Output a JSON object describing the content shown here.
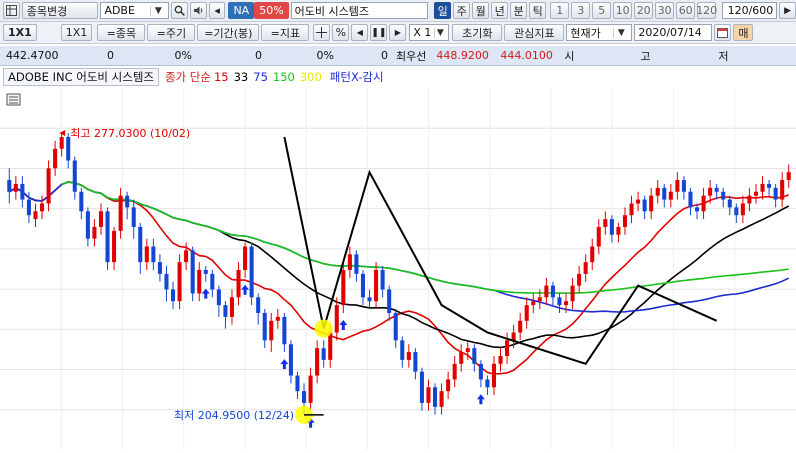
{
  "toolbar": {
    "mode_icon": "grid-icon",
    "code_change_label": "종목변경",
    "ticker": "ADBE",
    "name_na_badge": "NA",
    "name_pct_badge": "50%",
    "company_name": "어도비 시스템즈",
    "periods": [
      "일",
      "주",
      "월",
      "년",
      "분",
      "틱"
    ],
    "selected_period": "일",
    "intervals": [
      "1",
      "3",
      "5",
      "10",
      "20",
      "30",
      "60",
      "120"
    ],
    "count_display": "120/600",
    "date_nav_label": "▶"
  },
  "toolbar2": {
    "btn_1x1": "1X1",
    "btn_1x1_b": "1X1",
    "btn_items": "=종목",
    "btn_period": "=주기",
    "btn_range": "=기간(봉)",
    "btn_indicator": "=지표",
    "multiplier": "X 1",
    "reset_label": "초기화",
    "favorite_label": "관심지표",
    "price_type": "현재가",
    "date": "2020/07/14",
    "more_label": "매"
  },
  "quote": {
    "price": "442.4700",
    "change": "0",
    "change_pct": "0%",
    "volume": "0",
    "volume_pct": "0%",
    "ask_label": "최우선",
    "ask_price": "448.9200",
    "bid_price": "444.0100",
    "open_label": "시",
    "high_label": "고",
    "low_label": "저"
  },
  "legend": {
    "title": "ADOBE INC 어도비 시스템즈",
    "ma_prefix": "종가 단순",
    "ma_periods": [
      "15",
      "33",
      "75",
      "150",
      "300"
    ],
    "ma_colors": [
      "#e00000",
      "#000000",
      "#1d2bd0",
      "#19c219",
      "#e8e800"
    ],
    "pattern_label": "패턴X-감시"
  },
  "chart_data": {
    "type": "candlestick",
    "title": "ADOBE INC 어도비 시스템즈",
    "xlabel": "",
    "ylabel": "",
    "ylim": [
      198,
      287
    ],
    "x": [
      0,
      1,
      2,
      3,
      4,
      5,
      6,
      7,
      8,
      9,
      10,
      11,
      12,
      13,
      14,
      15,
      16,
      17,
      18,
      19,
      20,
      21,
      22,
      23,
      24,
      25,
      26,
      27,
      28,
      29,
      30,
      31,
      32,
      33,
      34,
      35,
      36,
      37,
      38,
      39,
      40,
      41,
      42,
      43,
      44,
      45,
      46,
      47,
      48,
      49,
      50,
      51,
      52,
      53,
      54,
      55,
      56,
      57,
      58,
      59,
      60,
      61,
      62,
      63,
      64,
      65,
      66,
      67,
      68,
      69,
      70,
      71,
      72,
      73,
      74,
      75,
      76,
      77,
      78,
      79,
      80,
      81,
      82,
      83,
      84,
      85,
      86,
      87,
      88,
      89,
      90,
      91,
      92,
      93,
      94,
      95,
      96,
      97,
      98,
      99,
      100,
      101,
      102,
      103,
      104,
      105,
      106,
      107,
      108,
      109,
      110,
      111,
      112,
      113,
      114,
      115,
      116,
      117,
      118,
      119
    ],
    "candles": {
      "open": [
        265,
        262,
        264,
        260,
        255,
        257,
        259,
        268,
        273,
        276,
        270,
        262,
        257,
        250,
        253,
        257,
        244,
        252,
        261,
        258,
        253,
        244,
        248,
        244,
        241,
        237,
        234,
        244,
        247,
        236,
        242,
        241,
        237,
        233,
        230,
        235,
        242,
        248,
        235,
        231,
        224,
        229,
        230,
        223,
        215,
        211,
        208,
        215,
        222,
        219,
        226,
        233,
        242,
        246,
        241,
        235,
        234,
        242,
        237,
        231,
        224,
        219,
        221,
        216,
        208,
        212,
        207,
        211,
        214,
        218,
        221,
        222,
        218,
        214,
        212,
        218,
        220,
        224,
        226,
        229,
        233,
        234,
        235,
        238,
        235,
        233,
        234,
        238,
        241,
        244,
        248,
        253,
        255,
        251,
        253,
        256,
        259,
        260,
        257,
        261,
        263,
        260,
        262,
        265,
        262,
        258,
        257,
        261,
        263,
        262,
        260,
        258,
        256,
        259,
        261,
        262,
        264,
        263,
        260,
        265
      ],
      "close": [
        262,
        264,
        260,
        256,
        257,
        259,
        268,
        273,
        276,
        270,
        262,
        257,
        250,
        253,
        257,
        244,
        252,
        261,
        258,
        253,
        244,
        248,
        244,
        241,
        237,
        234,
        244,
        247,
        236,
        242,
        241,
        237,
        233,
        230,
        235,
        242,
        248,
        235,
        231,
        224,
        229,
        230,
        223,
        215,
        211,
        208,
        215,
        222,
        219,
        226,
        233,
        242,
        246,
        241,
        235,
        234,
        242,
        237,
        231,
        224,
        219,
        221,
        216,
        208,
        212,
        207,
        211,
        214,
        218,
        221,
        222,
        218,
        214,
        212,
        218,
        220,
        224,
        226,
        229,
        233,
        234,
        235,
        238,
        235,
        233,
        234,
        238,
        241,
        244,
        248,
        253,
        255,
        251,
        253,
        256,
        259,
        260,
        257,
        261,
        263,
        260,
        262,
        265,
        262,
        258,
        257,
        261,
        263,
        262,
        260,
        258,
        256,
        259,
        261,
        262,
        264,
        263,
        260,
        265,
        267
      ],
      "high": [
        268,
        266,
        266,
        262,
        259,
        261,
        270,
        275,
        277,
        277,
        271,
        263,
        258,
        255,
        259,
        258,
        253,
        263,
        262,
        260,
        254,
        250,
        250,
        246,
        243,
        239,
        246,
        249,
        248,
        244,
        243,
        242,
        238,
        234,
        237,
        244,
        249,
        249,
        236,
        232,
        231,
        232,
        231,
        224,
        216,
        213,
        217,
        224,
        224,
        228,
        235,
        244,
        248,
        247,
        242,
        237,
        244,
        243,
        238,
        232,
        225,
        223,
        222,
        217,
        214,
        213,
        213,
        216,
        220,
        223,
        224,
        223,
        219,
        215,
        220,
        222,
        226,
        228,
        231,
        235,
        236,
        237,
        240,
        239,
        236,
        236,
        240,
        243,
        246,
        250,
        255,
        257,
        256,
        254,
        258,
        261,
        262,
        261,
        263,
        265,
        264,
        264,
        267,
        266,
        263,
        259,
        263,
        265,
        264,
        263,
        261,
        259,
        261,
        263,
        264,
        266,
        265,
        264,
        267,
        269
      ],
      "low": [
        259,
        260,
        258,
        254,
        253,
        255,
        257,
        266,
        271,
        268,
        260,
        255,
        248,
        248,
        251,
        242,
        242,
        250,
        255,
        250,
        241,
        242,
        242,
        239,
        234,
        232,
        232,
        242,
        234,
        234,
        239,
        235,
        230,
        227,
        228,
        233,
        240,
        233,
        228,
        222,
        221,
        227,
        221,
        213,
        209,
        205,
        206,
        213,
        217,
        217,
        224,
        231,
        240,
        239,
        233,
        232,
        232,
        235,
        229,
        222,
        217,
        217,
        214,
        206,
        206,
        205,
        205,
        209,
        212,
        216,
        219,
        216,
        212,
        210,
        210,
        216,
        218,
        222,
        224,
        227,
        231,
        232,
        233,
        233,
        231,
        231,
        232,
        236,
        239,
        242,
        246,
        251,
        249,
        249,
        251,
        254,
        257,
        255,
        255,
        259,
        258,
        258,
        260,
        260,
        256,
        255,
        255,
        259,
        260,
        258,
        256,
        254,
        254,
        257,
        259,
        260,
        261,
        258,
        258,
        263
      ]
    },
    "ma_series": [
      {
        "name": "15",
        "color": "#e00000"
      },
      {
        "name": "33",
        "color": "#000000"
      },
      {
        "name": "75",
        "color": "#1d2bd0"
      },
      {
        "name": "150",
        "color": "#19c219"
      },
      {
        "name": "300",
        "color": "#e8e800"
      }
    ],
    "annotations": {
      "high_label": "최고 277.0300 (10/02)",
      "high_index": 9,
      "high_value": 277.03,
      "low_label": "최저 204.9500 (12/24)",
      "low_index": 45,
      "low_value": 204.95,
      "signal_indices": [
        30,
        36,
        42,
        46,
        51,
        72
      ],
      "pattern_points": [
        [
          42,
          276
        ],
        [
          48,
          227
        ],
        [
          55,
          267
        ],
        [
          66,
          233
        ],
        [
          73,
          226
        ],
        [
          88,
          218
        ],
        [
          96,
          238
        ],
        [
          108,
          229
        ]
      ]
    },
    "grid": true
  }
}
